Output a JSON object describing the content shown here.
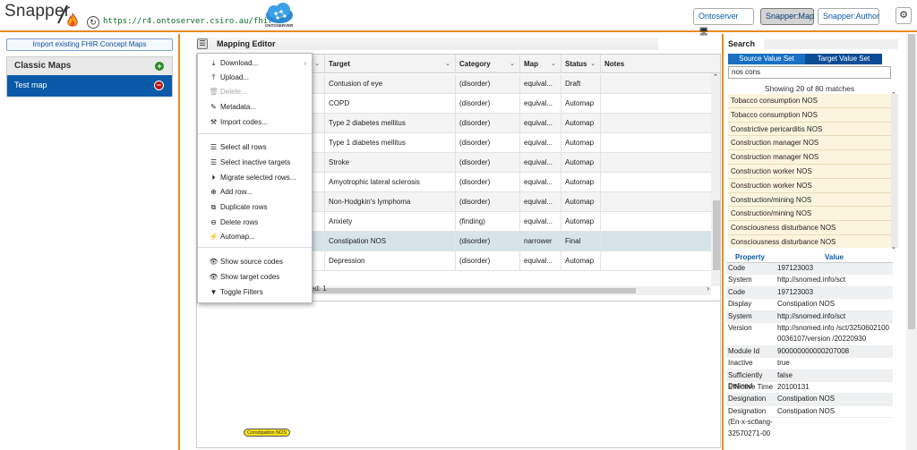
{
  "header": {
    "logo_text": "Snapper",
    "server_url": "https://r4.ontoserver.csiro.au/fhir",
    "ontoserver_label": "ONTOSERVER",
    "buttons": [
      "Ontoserver",
      "Snapper:Map",
      "Snapper:Author"
    ]
  },
  "left": {
    "import_label": "Import existing FHIR Concept Maps",
    "section_title": "Classic Maps",
    "maps": [
      "Test map"
    ]
  },
  "editor": {
    "title": "Mapping Editor",
    "columns": [
      "Target",
      "Category",
      "Map",
      "Status",
      "Notes"
    ],
    "rows": [
      [
        "Contusion of eye",
        "(disorder)",
        "equival...",
        "Draft",
        ""
      ],
      [
        "COPD",
        "(disorder)",
        "equival...",
        "Automap",
        ""
      ],
      [
        "Type 2 diabetes mellitus",
        "(disorder)",
        "equival...",
        "Automap",
        ""
      ],
      [
        "Type 1 diabetes mellitus",
        "(disorder)",
        "equival...",
        "Automap",
        ""
      ],
      [
        "Stroke",
        "(disorder)",
        "equival...",
        "Automap",
        ""
      ],
      [
        "Amyotrophic lateral sclerosis",
        "(disorder)",
        "equival...",
        "Automap",
        ""
      ],
      [
        "Non-Hodgkin's lymphoma",
        "(disorder)",
        "equival...",
        "Automap",
        ""
      ],
      [
        "Anxiety",
        "(finding)",
        "equival...",
        "Automap",
        ""
      ],
      [
        "Constipation NOS",
        "(disorder)",
        "narrower",
        "Final",
        ""
      ],
      [
        "Depression",
        "(disorder)",
        "equival...",
        "Automap",
        ""
      ]
    ],
    "selected_text": "elected: 1",
    "tag_label": "Constipation NOS"
  },
  "menu": {
    "items": [
      {
        "icon": "⤓",
        "label": "Download..."
      },
      {
        "icon": "⤒",
        "label": "Upload..."
      },
      {
        "icon": "🗑",
        "label": "Delete..."
      },
      {
        "icon": "✎",
        "label": "Metadata..."
      },
      {
        "icon": "⚒",
        "label": "Import codes..."
      },
      {
        "icon": "☰",
        "label": "Select all rows"
      },
      {
        "icon": "☰",
        "label": "Select inactive targets"
      },
      {
        "icon": "⏵",
        "label": "Migrate selected rows..."
      },
      {
        "icon": "⊕",
        "label": "Add row..."
      },
      {
        "icon": "⧉",
        "label": "Duplicate rows"
      },
      {
        "icon": "⊖",
        "label": "Delete rows"
      },
      {
        "icon": "⚡",
        "label": "Automap..."
      },
      {
        "icon": "👁",
        "label": "Show source codes"
      },
      {
        "icon": "👁",
        "label": "Show target codes"
      },
      {
        "icon": "▼",
        "label": "Toggle Filters"
      }
    ]
  },
  "search": {
    "title": "Search",
    "tabs": [
      "Source Value Set",
      "Target Value Set"
    ],
    "query": "nos cons",
    "match_count": "Showing 20 of 80 matches",
    "results": [
      "Tobacco consumption NOS",
      "Tobacco consumption NOS",
      "Constrictive pericarditis NOS",
      "Construction manager NOS",
      "Construction manager NOS",
      "Construction worker NOS",
      "Construction worker NOS",
      "Construction/mining NOS",
      "Construction/mining NOS",
      "Consciousness disturbance NOS",
      "Consciousness disturbance NOS"
    ],
    "prop_headers": [
      "Property",
      "Value"
    ],
    "properties": [
      [
        "Code",
        "197123003"
      ],
      [
        "System",
        "http://snomed.info/sct"
      ],
      [
        "Code",
        "197123003"
      ],
      [
        "Display",
        "Constipation NOS"
      ],
      [
        "System",
        "http://snomed.info/sct"
      ],
      [
        "Version",
        "http://snomed.info /sct/32506021000036107/version /20220930"
      ],
      [
        "Module Id",
        "900000000000207008"
      ],
      [
        "Inactive",
        "true"
      ],
      [
        "Sufficiently Defined",
        "false"
      ],
      [
        "Effective Time",
        "20100131"
      ],
      [
        "Designation",
        "Constipation NOS"
      ],
      [
        "Designation (En-x-sctlang-32570271-00",
        "Constipation NOS"
      ]
    ]
  },
  "colors": {
    "accent_orange": "#e88d1c",
    "primary_blue": "#0b5aa8",
    "highlight_yellow": "#f7f01a"
  }
}
